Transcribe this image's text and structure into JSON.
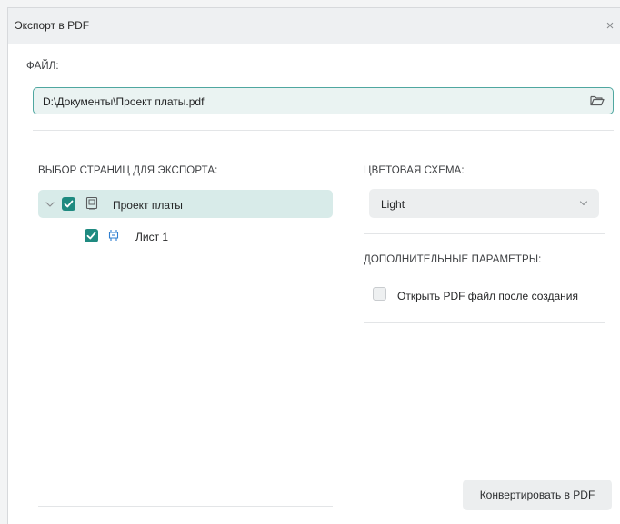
{
  "window": {
    "title": "Экспорт в PDF",
    "close_glyph": "×"
  },
  "file": {
    "label": "ФАЙЛ:",
    "path": "D:\\Документы\\Проект платы.pdf",
    "browse_icon": "folder-open-icon"
  },
  "pages": {
    "label": "ВЫБОР СТРАНИЦ ДЛЯ ЭКСПОРТА:",
    "tree": [
      {
        "label": "Проект платы",
        "checked": true,
        "expanded": true,
        "icon": "board-project-icon"
      },
      {
        "label": "Лист 1",
        "checked": true,
        "icon": "schematic-sheet-icon"
      }
    ]
  },
  "color_scheme": {
    "label": "ЦВЕТОВАЯ СХЕМА:",
    "selected": "Light"
  },
  "extra": {
    "label": "ДОПОЛНИТЕЛЬНЫЕ ПАРАМЕТРЫ:",
    "open_after": {
      "label": "Открыть PDF файл после создания",
      "checked": false
    }
  },
  "actions": {
    "convert_label": "Конвертировать в PDF"
  },
  "colors": {
    "accent": "#1f8a80",
    "selection_bg": "#d8ebe9",
    "input_border": "#4fa7a0"
  }
}
